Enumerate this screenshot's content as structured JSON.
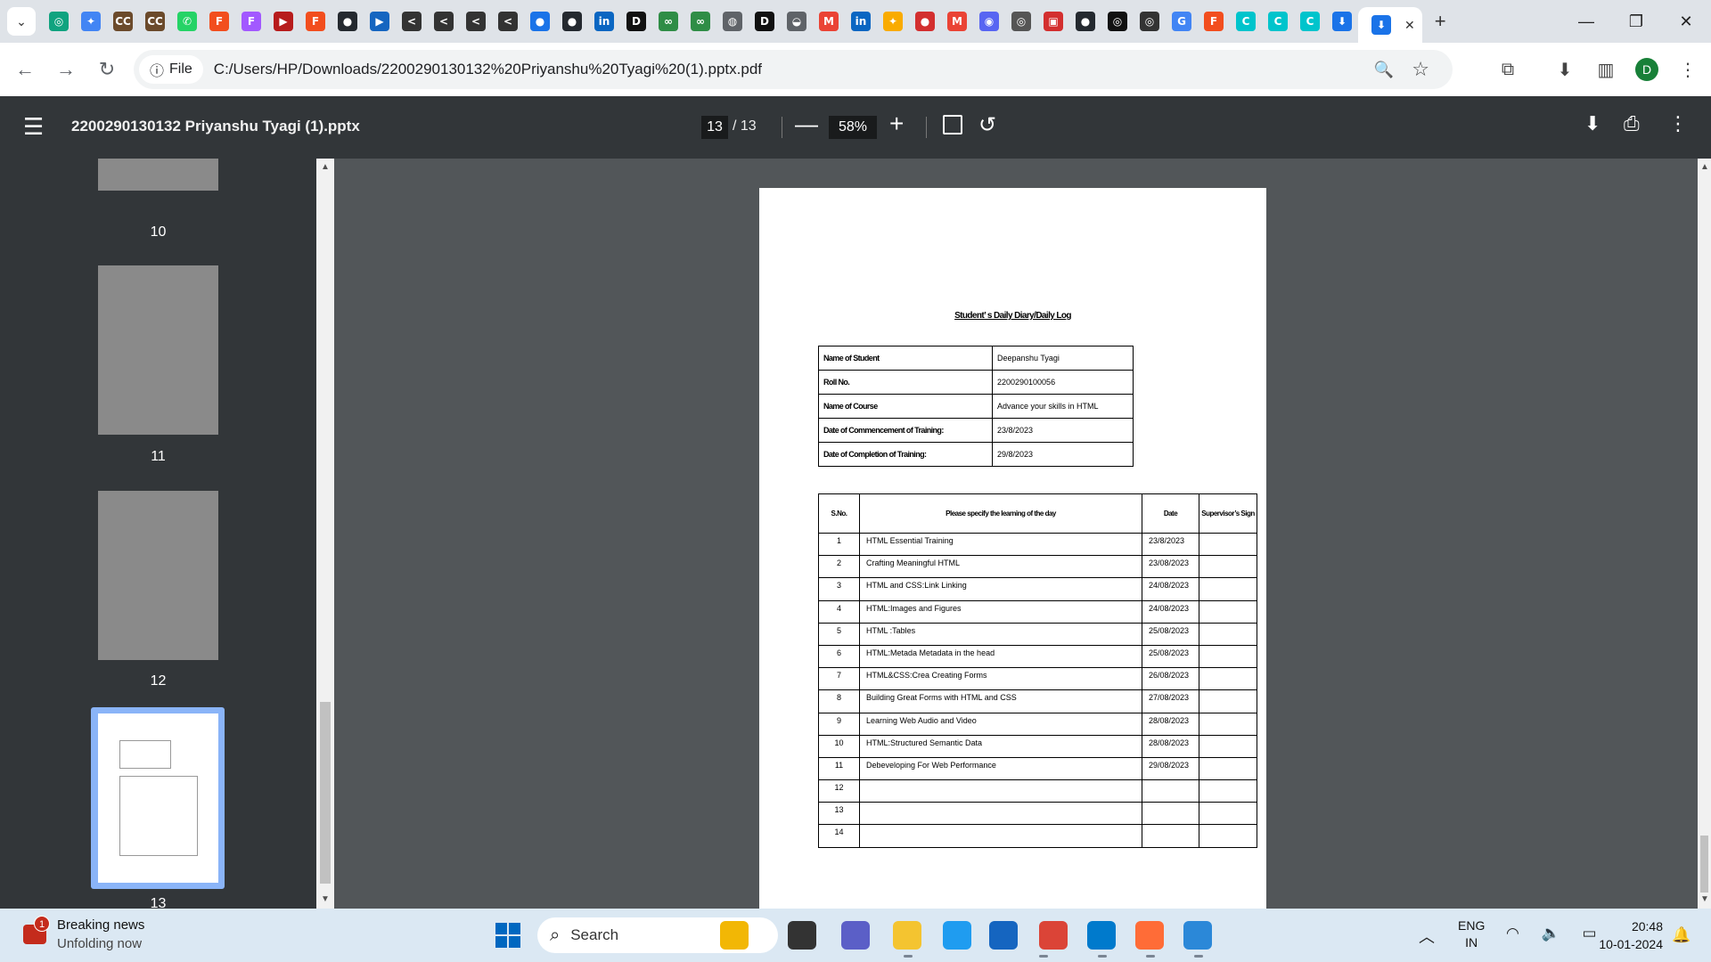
{
  "browser": {
    "tab_strip_icons": [
      {
        "name": "chatgpt-icon",
        "glyph": "◎",
        "color": "#10a37f"
      },
      {
        "name": "gemini-icon",
        "glyph": "✦",
        "color": "#4285f4"
      },
      {
        "name": "cc-icon",
        "glyph": "CC",
        "color": "#6b4a2b"
      },
      {
        "name": "cc-icon",
        "glyph": "CC",
        "color": "#6b4a2b"
      },
      {
        "name": "whatsapp-icon",
        "glyph": "✆",
        "color": "#25d366"
      },
      {
        "name": "figma-icon",
        "glyph": "F",
        "color": "#f24e1e"
      },
      {
        "name": "figma-icon",
        "glyph": "F",
        "color": "#a259ff"
      },
      {
        "name": "bookmark-icon",
        "glyph": "▶",
        "color": "#b71c1c"
      },
      {
        "name": "figma-icon",
        "glyph": "F",
        "color": "#f24e1e"
      },
      {
        "name": "github-icon",
        "glyph": "●",
        "color": "#24292f"
      },
      {
        "name": "video-icon",
        "glyph": "▶",
        "color": "#1565c0"
      },
      {
        "name": "code-icon",
        "glyph": "<",
        "color": "#333333"
      },
      {
        "name": "code-icon",
        "glyph": "<",
        "color": "#333333"
      },
      {
        "name": "code-icon",
        "glyph": "<",
        "color": "#333333"
      },
      {
        "name": "code-icon",
        "glyph": "<",
        "color": "#333333"
      },
      {
        "name": "record-icon",
        "glyph": "●",
        "color": "#1a73e8"
      },
      {
        "name": "github-icon",
        "glyph": "●",
        "color": "#24292f"
      },
      {
        "name": "linkedin-icon",
        "glyph": "in",
        "color": "#0a66c2"
      },
      {
        "name": "dev-icon",
        "glyph": "D",
        "color": "#111111"
      },
      {
        "name": "geeks-icon",
        "glyph": "∞",
        "color": "#2f8d46"
      },
      {
        "name": "geeks-icon",
        "glyph": "∞",
        "color": "#2f8d46"
      },
      {
        "name": "globe-icon",
        "glyph": "◍",
        "color": "#5f6368"
      },
      {
        "name": "dev-icon",
        "glyph": "D",
        "color": "#111111"
      },
      {
        "name": "incognito-icon",
        "glyph": "◒",
        "color": "#5f6368"
      },
      {
        "name": "gmail-icon",
        "glyph": "M",
        "color": "#ea4335"
      },
      {
        "name": "linkedin-icon",
        "glyph": "in",
        "color": "#0a66c2"
      },
      {
        "name": "idea-icon",
        "glyph": "✦",
        "color": "#f9ab00"
      },
      {
        "name": "pdf-icon",
        "glyph": "●",
        "color": "#d32f2f"
      },
      {
        "name": "gmail-icon",
        "glyph": "M",
        "color": "#ea4335"
      },
      {
        "name": "discord-icon",
        "glyph": "◉",
        "color": "#5865f2"
      },
      {
        "name": "chromium-icon",
        "glyph": "◎",
        "color": "#555555"
      },
      {
        "name": "app-icon",
        "glyph": "▣",
        "color": "#d32f2f"
      },
      {
        "name": "github-icon",
        "glyph": "●",
        "color": "#24292f"
      },
      {
        "name": "chatgpt-icon",
        "glyph": "◎",
        "color": "#111111"
      },
      {
        "name": "chatgpt-icon",
        "glyph": "◎",
        "color": "#333333"
      },
      {
        "name": "google-icon",
        "glyph": "G",
        "color": "#4285f4"
      },
      {
        "name": "figma-icon",
        "glyph": "F",
        "color": "#f24e1e"
      },
      {
        "name": "canva-icon",
        "glyph": "C",
        "color": "#00c4cc"
      },
      {
        "name": "canva-icon",
        "glyph": "C",
        "color": "#00c4cc"
      },
      {
        "name": "canva-icon",
        "glyph": "C",
        "color": "#00c4cc"
      },
      {
        "name": "download-icon",
        "glyph": "⬇",
        "color": "#1a73e8"
      }
    ],
    "active_tab_close": "✕",
    "new_tab": "+",
    "window_controls": {
      "minimize": "—",
      "maximize": "❐",
      "close": "✕"
    },
    "nav": {
      "back": "←",
      "forward": "→",
      "reload": "↻"
    },
    "site_chip": {
      "icon": "ⓘ",
      "label": "File"
    },
    "url": "C:/Users/HP/Downloads/2200290130132%20Priyanshu%20Tyagi%20(1).pptx.pdf",
    "toolbar_icons": {
      "zoom": "🔍",
      "star": "☆",
      "extensions": "⧉",
      "download": "⬇",
      "sidepanel": "▥",
      "menu": "⋮"
    },
    "profile_initial": "D",
    "profile_color": "#188038"
  },
  "pdf_toolbar": {
    "menu_glyph": "☰",
    "title": "2200290130132 Priyanshu Tyagi (1).pptx",
    "current_page": "13",
    "page_total": "/ 13",
    "zoom_out": "—",
    "zoom": "58%",
    "zoom_in": "+",
    "rotate": "↺",
    "download": "⬇",
    "print": "⎙",
    "more": "⋮"
  },
  "sidebar": {
    "thumbnails": [
      {
        "number": "10"
      },
      {
        "number": "11"
      },
      {
        "number": "12"
      },
      {
        "number": "13"
      }
    ]
  },
  "document": {
    "heading": "Student’ s Daily Diary/Daily Log",
    "info_rows": [
      {
        "label": "Name of Student",
        "value": "Deepanshu Tyagi"
      },
      {
        "label": "Roll No.",
        "value": "2200290100056"
      },
      {
        "label": "Name of Course",
        "value": "Advance your skills in HTML"
      },
      {
        "label": "Date of Commencement of Training:",
        "value": "23/8/2023"
      },
      {
        "label": "Date of Completion of Training:",
        "value": "29/8/2023"
      }
    ],
    "log_headers": {
      "sno": "S.No.",
      "learning": "Please specify the learning of the day",
      "date": "Date",
      "supervisor": "Supervisor’s Sign"
    },
    "log_rows": [
      {
        "sno": "1",
        "learning": "HTML Essential Training",
        "date": "23/8/2023"
      },
      {
        "sno": "2",
        "learning": "Crafting Meaningful HTML",
        "date": "23/08/2023"
      },
      {
        "sno": "3",
        "learning": "HTML and CSS:Link Linking",
        "date": "24/08/2023"
      },
      {
        "sno": "4",
        "learning": "HTML:Images and Figures",
        "date": "24/08/2023"
      },
      {
        "sno": "5",
        "learning": "HTML :Tables",
        "date": "25/08/2023"
      },
      {
        "sno": "6",
        "learning": "HTML:Metada Metadata in the head",
        "date": "25/08/2023"
      },
      {
        "sno": "7",
        "learning": "HTML&CSS:Crea Creating Forms",
        "date": "26/08/2023"
      },
      {
        "sno": "8",
        "learning": "Building Great Forms with HTML and CSS",
        "date": "27/08/2023"
      },
      {
        "sno": "9",
        "learning": "Learning Web Audio and Video",
        "date": "28/08/2023"
      },
      {
        "sno": "10",
        "learning": "HTML:Structured Semantic Data",
        "date": "28/08/2023"
      },
      {
        "sno": "11",
        "learning": "Debeveloping For Web Performance",
        "date": "29/08/2023"
      },
      {
        "sno": "12",
        "learning": "",
        "date": ""
      },
      {
        "sno": "13",
        "learning": "",
        "date": ""
      },
      {
        "sno": "14",
        "learning": "",
        "date": ""
      }
    ]
  },
  "taskbar": {
    "news_title": "Breaking news",
    "news_subtitle": "Unfolding now",
    "news_badge": "1",
    "search_label": "Search",
    "search_glyph": "⌕",
    "apps": [
      {
        "name": "widget-app-icon",
        "color": "#f2b705"
      },
      {
        "name": "task-view-icon",
        "color": "#333333"
      },
      {
        "name": "teams-icon",
        "color": "#5b5fc7"
      },
      {
        "name": "file-explorer-icon",
        "color": "#f4c430"
      },
      {
        "name": "vscode-insiders-icon",
        "color": "#1f9cf0"
      },
      {
        "name": "microsoft-store-icon",
        "color": "#1565c0"
      },
      {
        "name": "chrome-icon",
        "color": "#db4437"
      },
      {
        "name": "vscode-icon",
        "color": "#007acc"
      },
      {
        "name": "postman-icon",
        "color": "#ff6c37"
      },
      {
        "name": "paint-app-icon",
        "color": "#2b88d8"
      }
    ],
    "tray_chevron": "︿",
    "lang_top": "ENG",
    "lang_bottom": "IN",
    "tray_glyphs": "◠ 🔈 ▭",
    "time": "20:48",
    "date": "10-01-2024",
    "notification_glyph": "🔔"
  }
}
